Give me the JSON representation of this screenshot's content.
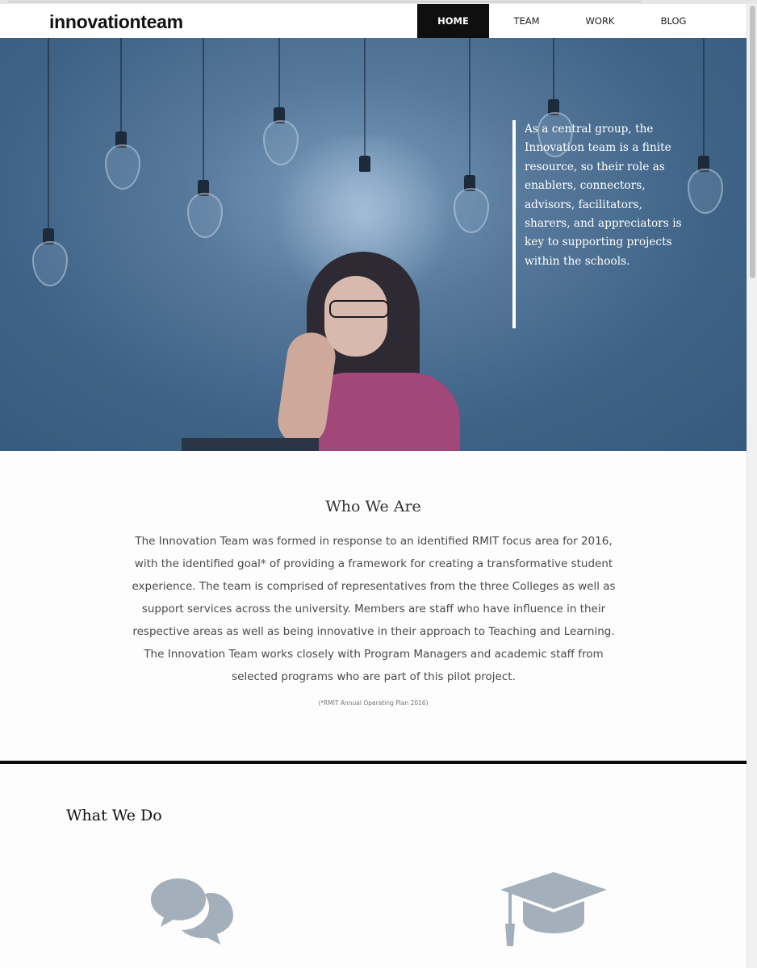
{
  "brand": {
    "logo": "innovationteam"
  },
  "nav": {
    "items": [
      {
        "label": "HOME",
        "active": true
      },
      {
        "label": "TEAM",
        "active": false
      },
      {
        "label": "WORK",
        "active": false
      },
      {
        "label": "BLOG",
        "active": false
      }
    ]
  },
  "hero": {
    "quote": "As a central group, the Innovation team is a finite resource, so their role as enablers, connectors, advisors, facilitators, sharers, and appreciators is key to supporting projects within the schools."
  },
  "who_we_are": {
    "title": "Who We Are",
    "body": "The Innovation Team was formed in response to an identified RMIT focus area for 2016, with the identified goal* of providing a framework for creating a transformative student experience. The team is comprised of representatives from the three Colleges as well as support services across the university.  Members are staff who have influence in their respective areas as well as being innovative in their approach to Teaching and Learning.  The Innovation Team works closely with Program Managers and academic staff from selected programs who are part of this pilot project.",
    "footnote": "(*RMIT Annual Operating Plan 2016)"
  },
  "what_we_do": {
    "title": "What We Do",
    "icons": [
      "speech-bubbles-icon",
      "graduation-cap-icon"
    ]
  },
  "colors": {
    "hero_overlay": "#3e6386",
    "nav_active_bg": "#0f0f0f",
    "icon_gray": "#a3b0bb",
    "divider": "#0c0c0c"
  }
}
